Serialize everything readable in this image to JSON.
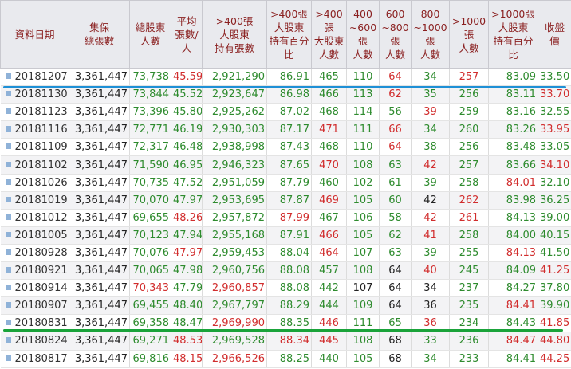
{
  "headers": [
    [
      "資料日期"
    ],
    [
      "集保",
      "總張數"
    ],
    [
      "總股東",
      "人數"
    ],
    [
      "平均",
      "張數/",
      "人"
    ],
    [
      ">400張",
      "大股東",
      "持有張數"
    ],
    [
      ">400張",
      "大股東",
      "持有百分",
      "比"
    ],
    [
      ">400",
      "張",
      "大股東",
      "人數"
    ],
    [
      "400",
      "~600",
      "張",
      "人數"
    ],
    [
      "600",
      "~800",
      "張",
      "人數"
    ],
    [
      "800",
      "~1000",
      "張",
      "人數"
    ],
    [
      ">1000",
      "張",
      "人數"
    ],
    [
      ">1000張",
      "大股東",
      "持有百分",
      "比"
    ],
    [
      "收盤",
      "價"
    ]
  ],
  "rows": [
    [
      "20181207",
      "3,361,447",
      "73,738",
      "45.59",
      "2,921,290",
      "86.91",
      "465",
      "110",
      "64",
      "34",
      "257",
      "83.09",
      "33.50"
    ],
    [
      "20181130",
      "3,361,447",
      "73,844",
      "45.52",
      "2,923,647",
      "86.98",
      "466",
      "113",
      "62",
      "35",
      "256",
      "83.11",
      "33.70"
    ],
    [
      "20181123",
      "3,361,447",
      "73,396",
      "45.80",
      "2,925,262",
      "87.02",
      "468",
      "114",
      "56",
      "39",
      "259",
      "83.16",
      "32.55"
    ],
    [
      "20181116",
      "3,361,447",
      "72,771",
      "46.19",
      "2,930,303",
      "87.17",
      "471",
      "111",
      "66",
      "34",
      "260",
      "83.26",
      "33.95"
    ],
    [
      "20181109",
      "3,361,447",
      "72,317",
      "46.48",
      "2,938,998",
      "87.43",
      "468",
      "110",
      "64",
      "38",
      "256",
      "83.48",
      "33.05"
    ],
    [
      "20181102",
      "3,361,447",
      "71,590",
      "46.95",
      "2,946,323",
      "87.65",
      "470",
      "108",
      "63",
      "42",
      "257",
      "83.66",
      "34.10"
    ],
    [
      "20181026",
      "3,361,447",
      "70,735",
      "47.52",
      "2,951,059",
      "87.79",
      "460",
      "102",
      "61",
      "39",
      "258",
      "84.01",
      "32.10"
    ],
    [
      "20181019",
      "3,361,447",
      "70,070",
      "47.97",
      "2,953,695",
      "87.87",
      "469",
      "105",
      "60",
      "42",
      "262",
      "83.98",
      "36.25"
    ],
    [
      "20181012",
      "3,361,447",
      "69,655",
      "48.26",
      "2,957,872",
      "87.99",
      "467",
      "106",
      "58",
      "42",
      "261",
      "84.13",
      "39.00"
    ],
    [
      "20181005",
      "3,361,447",
      "70,123",
      "47.94",
      "2,955,168",
      "87.91",
      "466",
      "105",
      "62",
      "41",
      "258",
      "84.00",
      "40.15"
    ],
    [
      "20180928",
      "3,361,447",
      "70,076",
      "47.97",
      "2,959,453",
      "88.04",
      "464",
      "107",
      "63",
      "39",
      "255",
      "84.13",
      "41.50"
    ],
    [
      "20180921",
      "3,361,447",
      "70,065",
      "47.98",
      "2,960,756",
      "88.08",
      "457",
      "108",
      "64",
      "40",
      "245",
      "84.09",
      "41.25"
    ],
    [
      "20180914",
      "3,361,447",
      "70,343",
      "47.79",
      "2,960,857",
      "88.08",
      "442",
      "107",
      "64",
      "34",
      "237",
      "84.27",
      "37.80"
    ],
    [
      "20180907",
      "3,361,447",
      "69,455",
      "48.40",
      "2,967,797",
      "88.29",
      "444",
      "109",
      "64",
      "36",
      "235",
      "84.41",
      "39.90"
    ],
    [
      "20180831",
      "3,361,447",
      "69,358",
      "48.47",
      "2,969,990",
      "88.35",
      "446",
      "111",
      "65",
      "36",
      "234",
      "84.43",
      "41.85"
    ],
    [
      "20180824",
      "3,361,447",
      "69,271",
      "48.53",
      "2,969,528",
      "88.34",
      "445",
      "108",
      "68",
      "33",
      "236",
      "84.47",
      "44.80"
    ],
    [
      "20180817",
      "3,361,447",
      "69,816",
      "48.15",
      "2,966,526",
      "88.25",
      "440",
      "105",
      "68",
      "34",
      "233",
      "84.41",
      "44.25"
    ]
  ],
  "cell_colors": [
    [
      "black",
      "black",
      "green",
      "red",
      "green",
      "green",
      "green",
      "green",
      "red",
      "green",
      "red",
      "green",
      "green"
    ],
    [
      "black",
      "black",
      "green",
      "green",
      "green",
      "green",
      "green",
      "green",
      "red",
      "green",
      "green",
      "green",
      "red"
    ],
    [
      "black",
      "black",
      "green",
      "green",
      "green",
      "green",
      "green",
      "green",
      "green",
      "red",
      "green",
      "green",
      "green"
    ],
    [
      "black",
      "black",
      "green",
      "green",
      "green",
      "green",
      "red",
      "green",
      "red",
      "green",
      "green",
      "green",
      "red"
    ],
    [
      "black",
      "black",
      "green",
      "green",
      "green",
      "green",
      "green",
      "green",
      "red",
      "green",
      "green",
      "green",
      "green"
    ],
    [
      "black",
      "black",
      "green",
      "green",
      "green",
      "green",
      "red",
      "green",
      "green",
      "red",
      "green",
      "green",
      "red"
    ],
    [
      "black",
      "black",
      "green",
      "green",
      "green",
      "green",
      "green",
      "green",
      "green",
      "green",
      "green",
      "red",
      "green"
    ],
    [
      "black",
      "black",
      "green",
      "green",
      "green",
      "green",
      "red",
      "green",
      "green",
      "black",
      "red",
      "green",
      "green"
    ],
    [
      "black",
      "black",
      "green",
      "red",
      "green",
      "red",
      "green",
      "green",
      "green",
      "red",
      "red",
      "green",
      "green"
    ],
    [
      "black",
      "black",
      "green",
      "green",
      "green",
      "green",
      "red",
      "green",
      "green",
      "red",
      "green",
      "green",
      "green"
    ],
    [
      "black",
      "black",
      "green",
      "red",
      "green",
      "green",
      "red",
      "green",
      "green",
      "green",
      "green",
      "red",
      "green"
    ],
    [
      "black",
      "black",
      "green",
      "green",
      "green",
      "green",
      "green",
      "green",
      "black",
      "red",
      "green",
      "green",
      "red"
    ],
    [
      "black",
      "black",
      "red",
      "green",
      "red",
      "green",
      "green",
      "black",
      "black",
      "black",
      "green",
      "green",
      "green"
    ],
    [
      "black",
      "black",
      "green",
      "green",
      "green",
      "green",
      "green",
      "green",
      "black",
      "black",
      "green",
      "red",
      "green"
    ],
    [
      "black",
      "black",
      "green",
      "green",
      "red",
      "green",
      "red",
      "green",
      "green",
      "red",
      "green",
      "green",
      "red"
    ],
    [
      "black",
      "black",
      "green",
      "red",
      "green",
      "red",
      "red",
      "green",
      "black",
      "green",
      "green",
      "red",
      "red"
    ],
    [
      "black",
      "black",
      "green",
      "red",
      "red",
      "green",
      "green",
      "green",
      "black",
      "green",
      "green",
      "green",
      "red"
    ]
  ],
  "highlight_colors": {
    "blue": "#1e90d6",
    "green": "#1aa33a"
  }
}
